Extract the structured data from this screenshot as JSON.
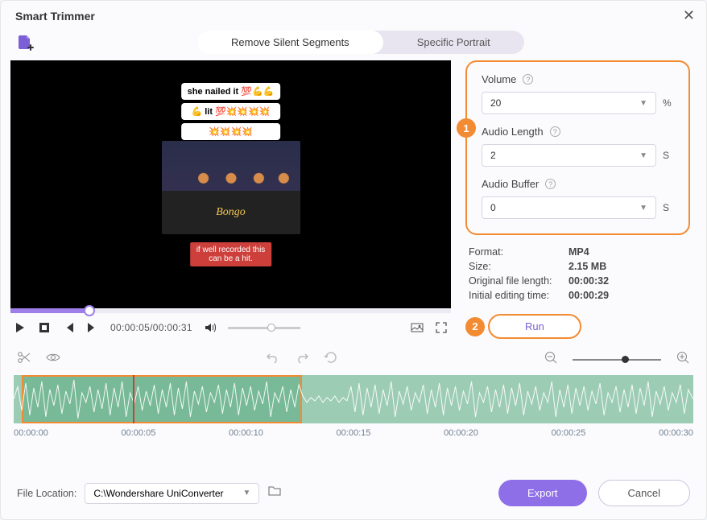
{
  "window": {
    "title": "Smart Trimmer"
  },
  "tabs": {
    "remove_silent": "Remove Silent Segments",
    "specific_portrait": "Specific Portrait"
  },
  "preview": {
    "sticker_line1": "she nailed it 💯💪💪",
    "sticker_line2": "💪 lit 💯💥💥💥💥",
    "sticker_line3": "💥💥💥💥",
    "banner_text": "Bongo",
    "caption_line1": "if well recorded this",
    "caption_line2": "can be a hit.",
    "time_current": "00:00:05",
    "time_total": "00:00:31"
  },
  "settings": {
    "volume_label": "Volume",
    "volume_value": "20",
    "volume_unit": "%",
    "audio_length_label": "Audio Length",
    "audio_length_value": "2",
    "audio_length_unit": "S",
    "audio_buffer_label": "Audio Buffer",
    "audio_buffer_value": "0",
    "audio_buffer_unit": "S"
  },
  "info": {
    "format_k": "Format:",
    "format_v": "MP4",
    "size_k": "Size:",
    "size_v": "2.15 MB",
    "orig_len_k": "Original file length:",
    "orig_len_v": "00:00:32",
    "init_time_k": "Initial editing time:",
    "init_time_v": "00:00:29"
  },
  "actions": {
    "run": "Run",
    "export": "Export",
    "cancel": "Cancel"
  },
  "ruler": {
    "t0": "00:00:00",
    "t1": "00:00:05",
    "t2": "00:00:10",
    "t3": "00:00:15",
    "t4": "00:00:20",
    "t5": "00:00:25",
    "t6": "00:00:30"
  },
  "file_location": {
    "label": "File Location:",
    "path": "C:\\Wondershare UniConverter"
  },
  "badges": {
    "one": "1",
    "two": "2"
  }
}
